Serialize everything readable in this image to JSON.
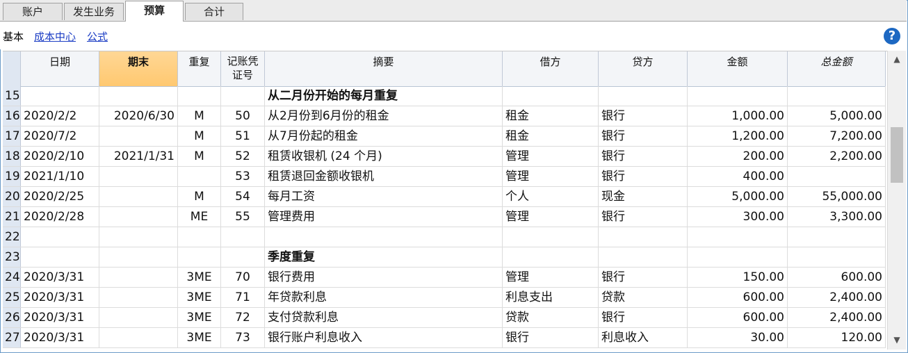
{
  "tabs": [
    {
      "label": "账户",
      "active": false
    },
    {
      "label": "发生业务",
      "active": false
    },
    {
      "label": "预算",
      "active": true
    },
    {
      "label": "合计",
      "active": false
    }
  ],
  "subtoolbar": {
    "base_label": "基本",
    "links": [
      "成本中心",
      "公式"
    ]
  },
  "help_icon": "?",
  "columns": {
    "date": "日期",
    "end": "期末",
    "repeat": "重复",
    "doc_line1": "记账凭",
    "doc_line2": "证号",
    "desc": "摘要",
    "debit": "借方",
    "credit": "贷方",
    "amount": "金额",
    "total": "总金额"
  },
  "rows": [
    {
      "n": "15",
      "date": "",
      "end": "",
      "repeat": "",
      "doc": "",
      "desc": "从二月份开始的每月重复",
      "debit": "",
      "credit": "",
      "amount": "",
      "total": "",
      "bold": true
    },
    {
      "n": "16",
      "date": "2020/2/2",
      "end": "2020/6/30",
      "repeat": "M",
      "doc": "50",
      "desc": "从2月份到6月份的租金",
      "debit": "租金",
      "credit": "银行",
      "amount": "1,000.00",
      "total": "5,000.00"
    },
    {
      "n": "17",
      "date": "2020/7/2",
      "end": "",
      "repeat": "M",
      "doc": "51",
      "desc": "从7月份起的租金",
      "debit": "租金",
      "credit": "银行",
      "amount": "1,200.00",
      "total": "7,200.00"
    },
    {
      "n": "18",
      "date": "2020/2/10",
      "end": "2021/1/31",
      "repeat": "M",
      "doc": "52",
      "desc": "租赁收银机 (24 个月)",
      "debit": "管理",
      "credit": "银行",
      "amount": "200.00",
      "total": "2,200.00"
    },
    {
      "n": "19",
      "date": "2021/1/10",
      "end": "",
      "repeat": "",
      "doc": "53",
      "desc": "租赁退回金额收银机",
      "debit": "管理",
      "credit": "银行",
      "amount": "400.00",
      "total": ""
    },
    {
      "n": "20",
      "date": "2020/2/25",
      "end": "",
      "repeat": "M",
      "doc": "54",
      "desc": "每月工资",
      "debit": "个人",
      "credit": "现金",
      "amount": "5,000.00",
      "total": "55,000.00"
    },
    {
      "n": "21",
      "date": "2020/2/28",
      "end": "",
      "repeat": "ME",
      "doc": "55",
      "desc": "管理费用",
      "debit": "管理",
      "credit": "银行",
      "amount": "300.00",
      "total": "3,300.00"
    },
    {
      "n": "22",
      "date": "",
      "end": "",
      "repeat": "",
      "doc": "",
      "desc": "",
      "debit": "",
      "credit": "",
      "amount": "",
      "total": ""
    },
    {
      "n": "23",
      "date": "",
      "end": "",
      "repeat": "",
      "doc": "",
      "desc": "季度重复",
      "debit": "",
      "credit": "",
      "amount": "",
      "total": "",
      "bold": true
    },
    {
      "n": "24",
      "date": "2020/3/31",
      "end": "",
      "repeat": "3ME",
      "doc": "70",
      "desc": "银行费用",
      "debit": "管理",
      "credit": "银行",
      "amount": "150.00",
      "total": "600.00"
    },
    {
      "n": "25",
      "date": "2020/3/31",
      "end": "",
      "repeat": "3ME",
      "doc": "71",
      "desc": "年贷款利息",
      "debit": "利息支出",
      "credit": "贷款",
      "amount": "600.00",
      "total": "2,400.00"
    },
    {
      "n": "26",
      "date": "2020/3/31",
      "end": "",
      "repeat": "3ME",
      "doc": "72",
      "desc": "支付贷款利息",
      "debit": "贷款",
      "credit": "银行",
      "amount": "600.00",
      "total": "2,400.00"
    },
    {
      "n": "27",
      "date": "2020/3/31",
      "end": "",
      "repeat": "3ME",
      "doc": "73",
      "desc": "银行账户利息收入",
      "debit": "银行",
      "credit": "利息收入",
      "amount": "30.00",
      "total": "120.00"
    }
  ]
}
